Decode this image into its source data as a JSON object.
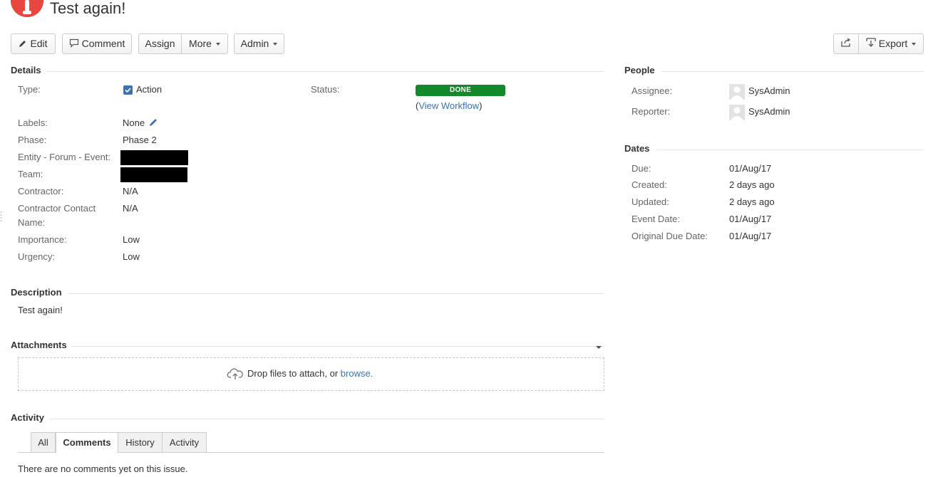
{
  "issue": {
    "title": "Test again!"
  },
  "toolbar": {
    "edit": "Edit",
    "comment": "Comment",
    "assign": "Assign",
    "more": "More",
    "admin": "Admin",
    "export": "Export",
    "share_icon": "share-icon"
  },
  "details": {
    "heading": "Details",
    "type_label": "Type:",
    "type_value": "Action",
    "status_label": "Status:",
    "status_value": "DONE",
    "status_color": "#14892c",
    "workflow_open": "(",
    "workflow_link": "View Workflow",
    "workflow_close": ")",
    "labels_label": "Labels:",
    "labels_value": "None",
    "phase_label": "Phase:",
    "phase_value": "Phase 2",
    "entity_label": "Entity - Forum - Event:",
    "team_label": "Team:",
    "contractor_label": "Contractor:",
    "contractor_value": "N/A",
    "contractor_contact_label_1": "Contractor Contact",
    "contractor_contact_label_2": "Name:",
    "contractor_contact_value": "N/A",
    "importance_label": "Importance:",
    "importance_value": "Low",
    "urgency_label": "Urgency:",
    "urgency_value": "Low"
  },
  "people": {
    "heading": "People",
    "assignee_label": "Assignee:",
    "assignee_value": "SysAdmin",
    "reporter_label": "Reporter:",
    "reporter_value": "SysAdmin"
  },
  "dates": {
    "heading": "Dates",
    "due_label": "Due:",
    "due_value": "01/Aug/17",
    "created_label": "Created:",
    "created_value": "2 days ago",
    "updated_label": "Updated:",
    "updated_value": "2 days ago",
    "event_label": "Event Date:",
    "event_value": "01/Aug/17",
    "original_due_label": "Original Due Date:",
    "original_due_value": "01/Aug/17"
  },
  "description": {
    "heading": "Description",
    "text": "Test again!"
  },
  "attachments": {
    "heading": "Attachments",
    "drop_text": "Drop files to attach, or ",
    "browse": "browse."
  },
  "activity": {
    "heading": "Activity",
    "tabs": [
      "All",
      "Comments",
      "History",
      "Activity"
    ],
    "active_tab": "Comments",
    "empty_text": "There are no comments yet on this issue."
  },
  "colors": {
    "accent": "#3b73af",
    "project_avatar": "#e8473f",
    "checkbox": "#3b73af"
  }
}
